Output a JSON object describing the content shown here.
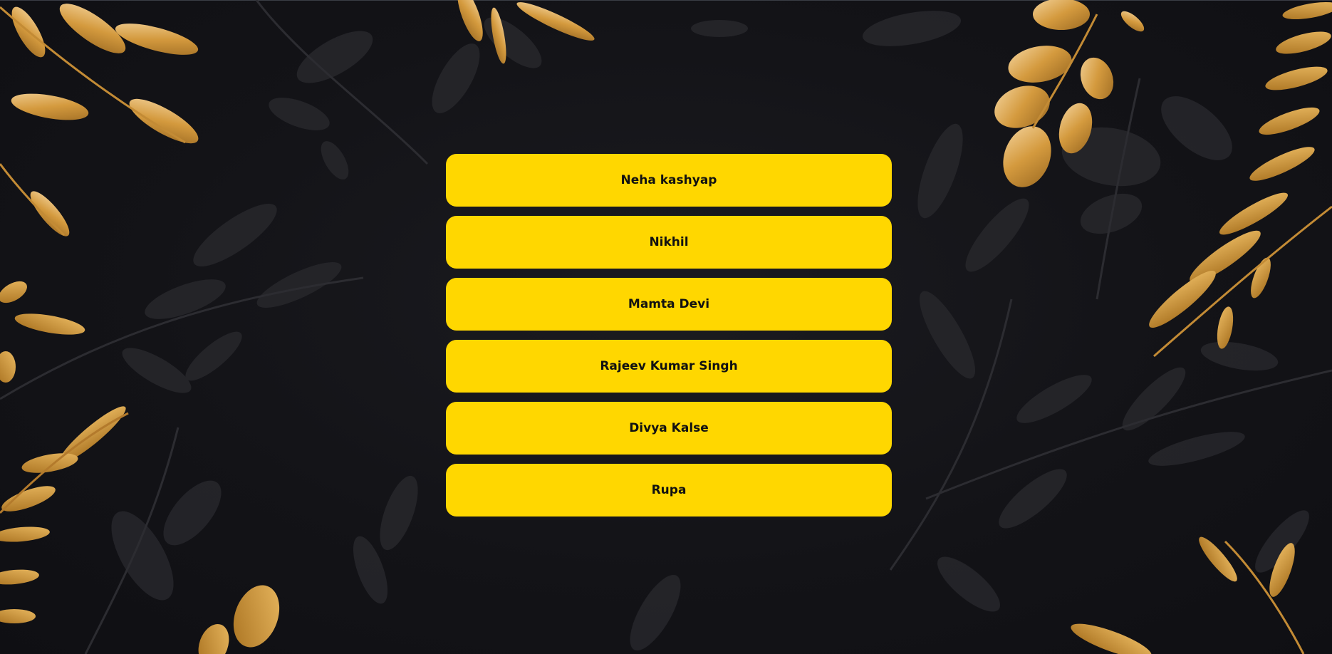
{
  "people_list": {
    "items": [
      {
        "label": "Neha kashyap"
      },
      {
        "label": "Nikhil"
      },
      {
        "label": "Mamta Devi"
      },
      {
        "label": "Rajeev Kumar Singh"
      },
      {
        "label": "Divya Kalse"
      },
      {
        "label": "Rupa"
      }
    ]
  },
  "theme": {
    "button_color": "#ffd700",
    "background_color": "#141419",
    "accent_gold": "#d4a24a",
    "leaf_dark": "#2a2a2f"
  },
  "decor": {
    "background_icon": "botanical-leaves-illustration"
  }
}
